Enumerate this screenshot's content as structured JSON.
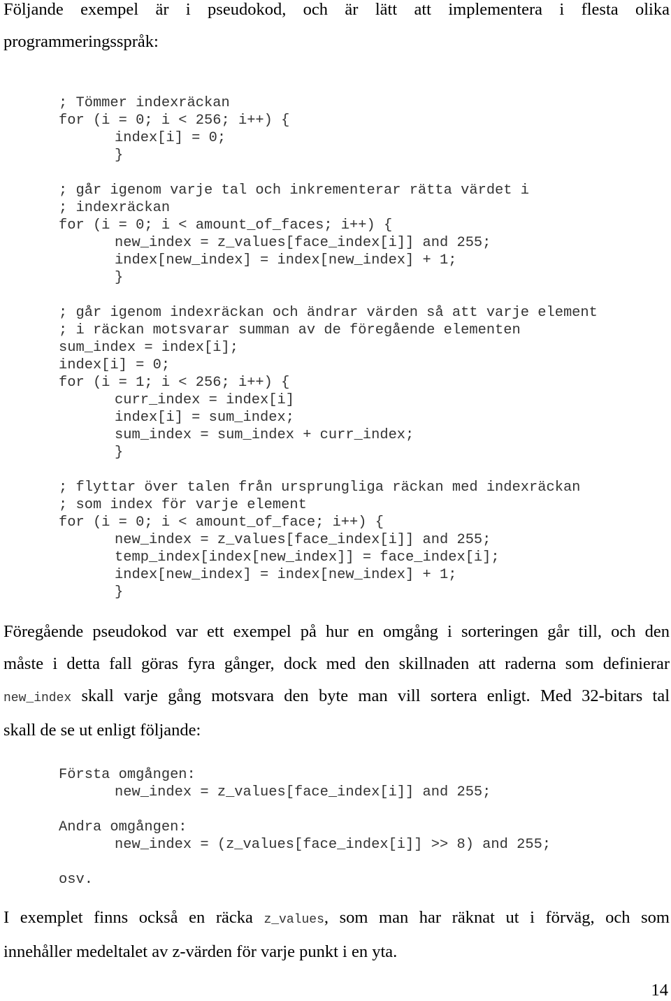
{
  "intro_paragraph": {
    "line1": "Följande exempel är i pseudokod, och är lätt att implementera i flesta olika",
    "line2": "programmeringsspråk:"
  },
  "code_block": {
    "lines": [
      {
        "text": "; Tömmer indexräckan",
        "indent": 0
      },
      {
        "text": "for (i = 0; i < 256; i++) {",
        "indent": 0
      },
      {
        "text": "index[i] = 0;",
        "indent": 1
      },
      {
        "text": "}",
        "indent": 1
      },
      {
        "text": "",
        "indent": 0
      },
      {
        "text": "; går igenom varje tal och inkrementerar rätta värdet i",
        "indent": 0
      },
      {
        "text": "; indexräckan",
        "indent": 0
      },
      {
        "text": "for (i = 0; i < amount_of_faces; i++) {",
        "indent": 0
      },
      {
        "text": "new_index = z_values[face_index[i]] and 255;",
        "indent": 1
      },
      {
        "text": "index[new_index] = index[new_index] + 1;",
        "indent": 1
      },
      {
        "text": "}",
        "indent": 1
      },
      {
        "text": "",
        "indent": 0
      },
      {
        "text": "; går igenom indexräckan och ändrar värden så att varje element",
        "indent": 0
      },
      {
        "text": "; i räckan motsvarar summan av de föregående elementen",
        "indent": 0
      },
      {
        "text": "sum_index = index[i];",
        "indent": 0
      },
      {
        "text": "index[i] = 0;",
        "indent": 0
      },
      {
        "text": "for (i = 1; i < 256; i++) {",
        "indent": 0
      },
      {
        "text": "curr_index = index[i]",
        "indent": 1
      },
      {
        "text": "index[i] = sum_index;",
        "indent": 1
      },
      {
        "text": "sum_index = sum_index + curr_index;",
        "indent": 1
      },
      {
        "text": "}",
        "indent": 1
      },
      {
        "text": "",
        "indent": 0
      },
      {
        "text": "; flyttar över talen från ursprungliga räckan med indexräckan",
        "indent": 0
      },
      {
        "text": "; som index för varje element",
        "indent": 0
      },
      {
        "text": "for (i = 0; i < amount_of_face; i++) {",
        "indent": 0
      },
      {
        "text": "new_index = z_values[face_index[i]] and 255;",
        "indent": 1
      },
      {
        "text": "temp_index[index[new_index]] = face_index[i];",
        "indent": 1
      },
      {
        "text": "index[new_index] = index[new_index] + 1;",
        "indent": 1
      },
      {
        "text": "}",
        "indent": 1
      }
    ]
  },
  "explanation_paragraph": {
    "line1": "Föregående pseudokod var ett exempel på hur en omgång i sorteringen går till, och den",
    "line2": "måste i detta fall göras fyra gånger, dock med den skillnaden att raderna som definierar",
    "line3_code": "new_index",
    "line3_text": " skall varje gång motsvara den byte man vill sortera enligt. Med 32-bitars tal",
    "line4": "skall de se ut enligt följande:"
  },
  "passes_block": {
    "lines": [
      {
        "text": "Första omgången:",
        "indent": 0
      },
      {
        "text": "new_index = z_values[face_index[i]] and 255;",
        "indent": 1
      },
      {
        "text": "",
        "indent": 0
      },
      {
        "text": "Andra omgången:",
        "indent": 0
      },
      {
        "text": "new_index = (z_values[face_index[i]] >> 8) and 255;",
        "indent": 1
      },
      {
        "text": "",
        "indent": 0
      },
      {
        "text": "osv.",
        "indent": 0
      }
    ]
  },
  "closing_paragraph": {
    "line1_before": "I exemplet finns också en räcka ",
    "line1_code": "z_values",
    "line1_after": ", som man har räknat ut i förväg, och som",
    "line2": "innehåller medeltalet av z-värden för varje punkt i en yta."
  },
  "page_number": "14"
}
